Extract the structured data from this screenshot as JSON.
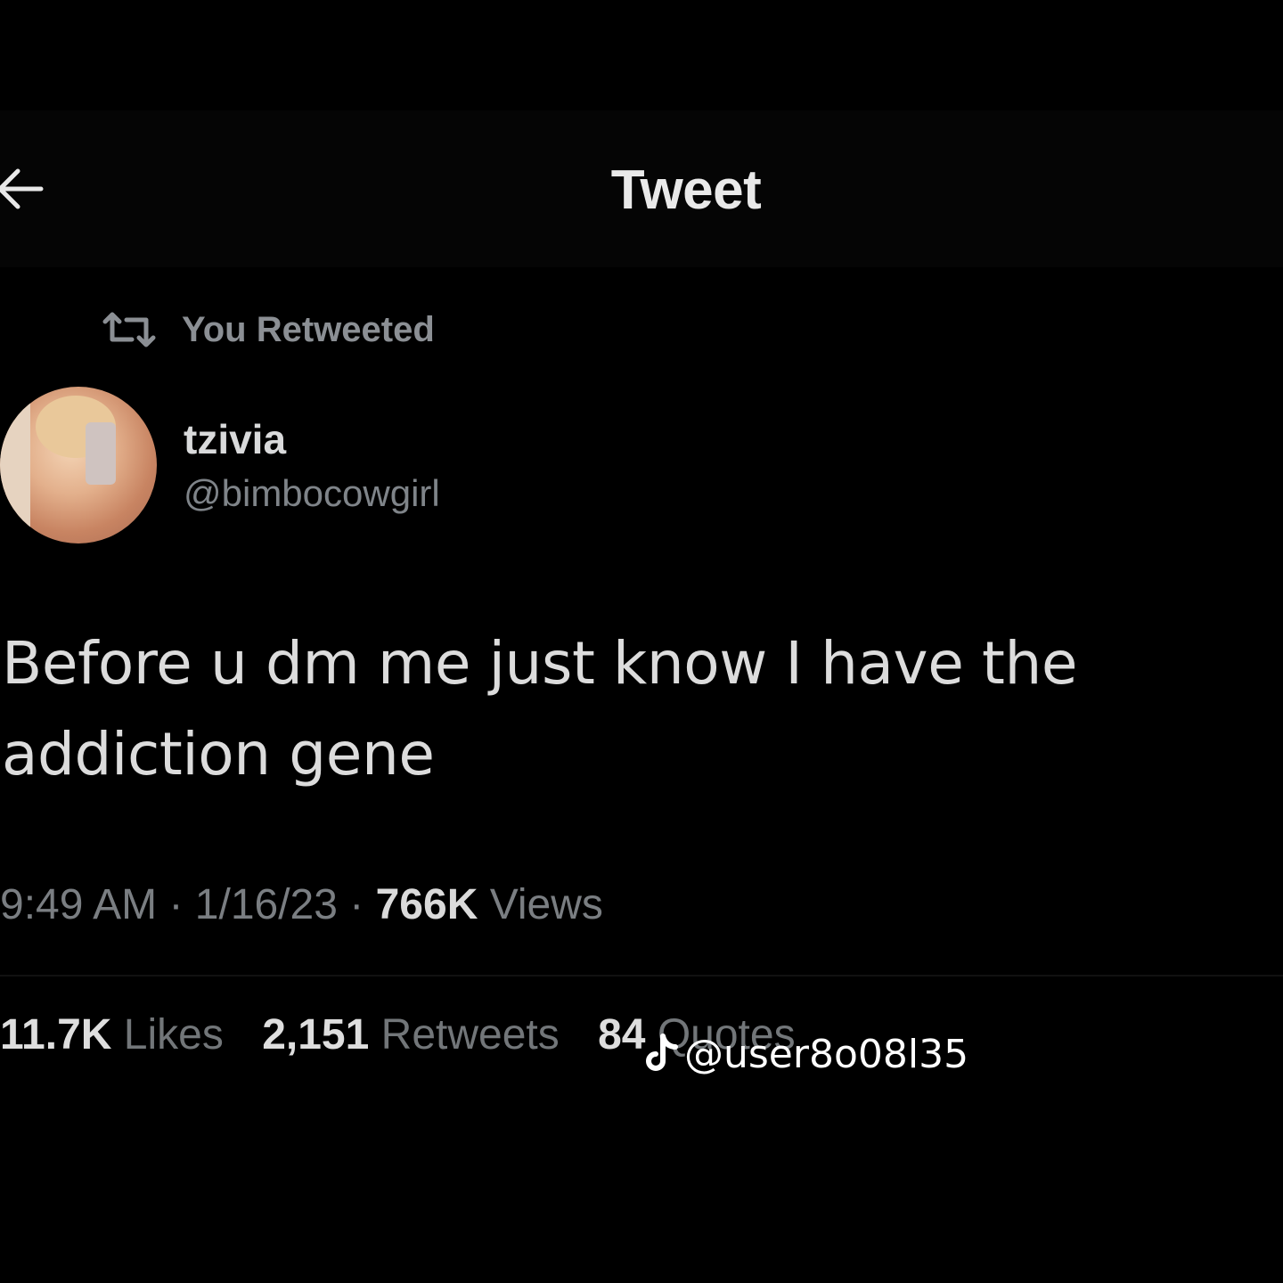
{
  "header": {
    "title": "Tweet",
    "back_icon": "arrow-left-icon"
  },
  "retweet_context": {
    "icon": "retweet-icon",
    "label": "You Retweeted"
  },
  "author": {
    "name": "tzivia",
    "handle": "@bimbocowgirl"
  },
  "tweet": {
    "text": "Before u dm me just know I have the addiction gene"
  },
  "meta": {
    "time": "9:49 AM",
    "separator": "·",
    "date": "1/16/23",
    "views_count": "766K",
    "views_label": "Views"
  },
  "stats": {
    "likes_count": "11.7K",
    "likes_label": "Likes",
    "retweets_count": "2,151",
    "retweets_label": "Retweets",
    "quotes_count": "84",
    "quotes_label": "Quotes"
  },
  "watermark": {
    "icon": "tiktok-icon",
    "user": "@user8o08l35"
  },
  "colors": {
    "background": "#000000",
    "primary_text": "#e7e9ea",
    "secondary_text": "#7a7e82"
  }
}
